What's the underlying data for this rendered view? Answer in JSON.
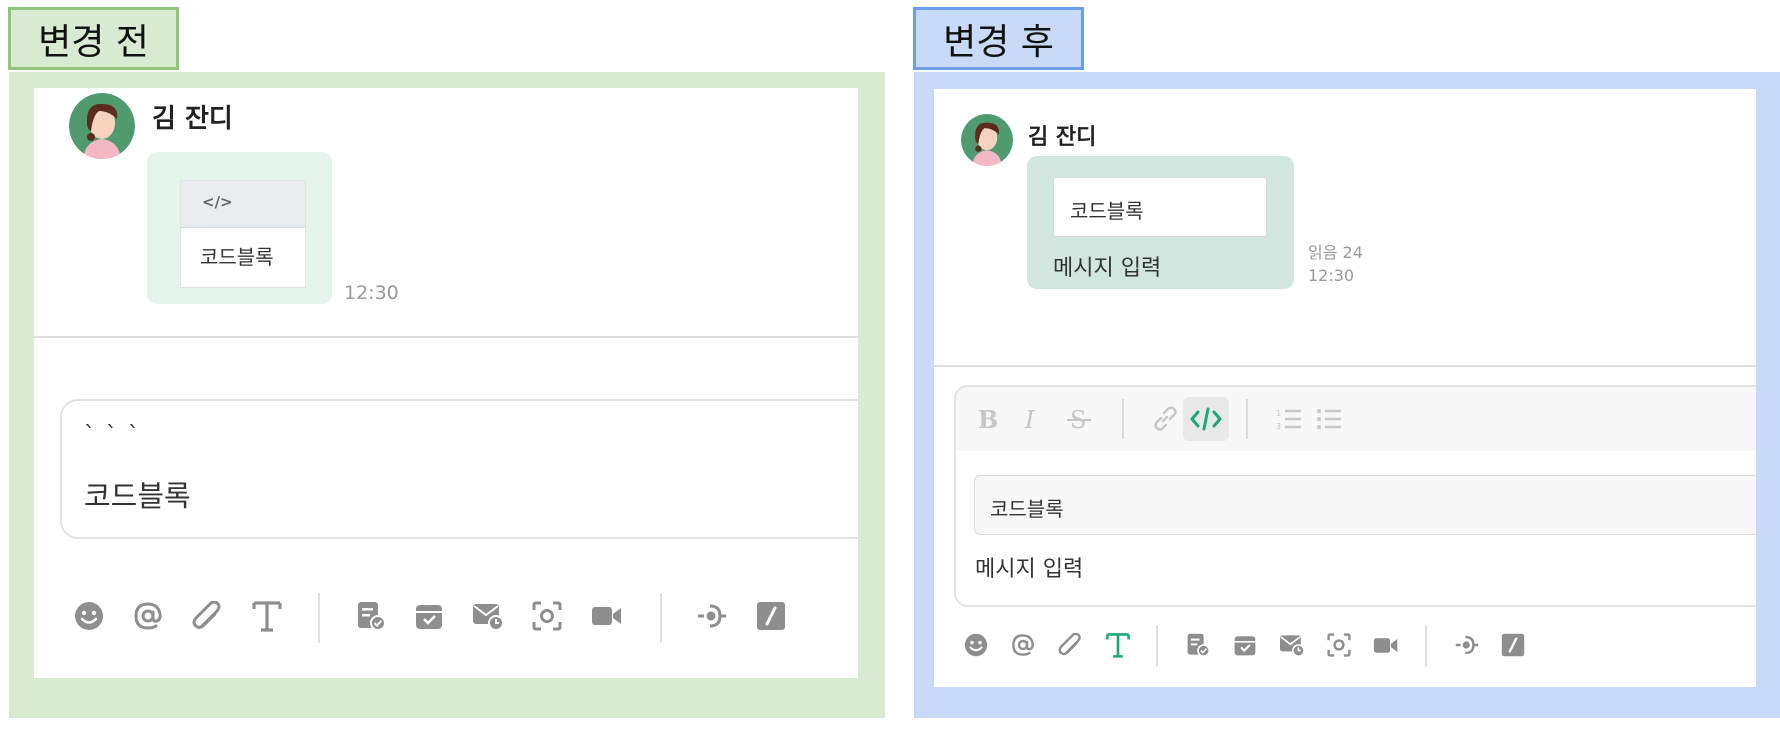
{
  "before": {
    "label": "변경 전",
    "sender": "김 잔디",
    "code_icon_text": "</>",
    "code_text": "코드블록",
    "time": "12:30",
    "input_backticks": "` ` `",
    "input_text": "코드블록",
    "toolbar_icons": [
      "emoji-icon",
      "mention-icon",
      "attach-icon",
      "text-format-icon",
      "todo-icon",
      "archive-icon",
      "scheduled-mail-icon",
      "screen-capture-icon",
      "video-icon",
      "plugin-icon",
      "slash-command-icon"
    ]
  },
  "after": {
    "label": "변경 후",
    "sender": "김 잔디",
    "code_text": "코드블록",
    "message_text": "메시지 입력",
    "read_count": "읽음 24",
    "time": "12:30",
    "format_icons": [
      "bold-icon",
      "italic-icon",
      "strikethrough-icon",
      "link-icon",
      "code-block-icon",
      "ordered-list-icon",
      "bullet-list-icon"
    ],
    "input_code_text": "코드블록",
    "input_message_text": "메시지 입력",
    "toolbar_icons": [
      "emoji-icon",
      "mention-icon",
      "attach-icon",
      "text-format-icon",
      "todo-icon",
      "archive-icon",
      "scheduled-mail-icon",
      "screen-capture-icon",
      "video-icon",
      "plugin-icon",
      "slash-command-icon"
    ]
  },
  "colors": {
    "before_label_bg": "#d9ead3",
    "before_label_border": "#93c47d",
    "after_label_bg": "#c9daf8",
    "after_label_border": "#6d9eeb",
    "accent_green": "#1aa97a",
    "icon_gray": "#8e8e8e"
  }
}
